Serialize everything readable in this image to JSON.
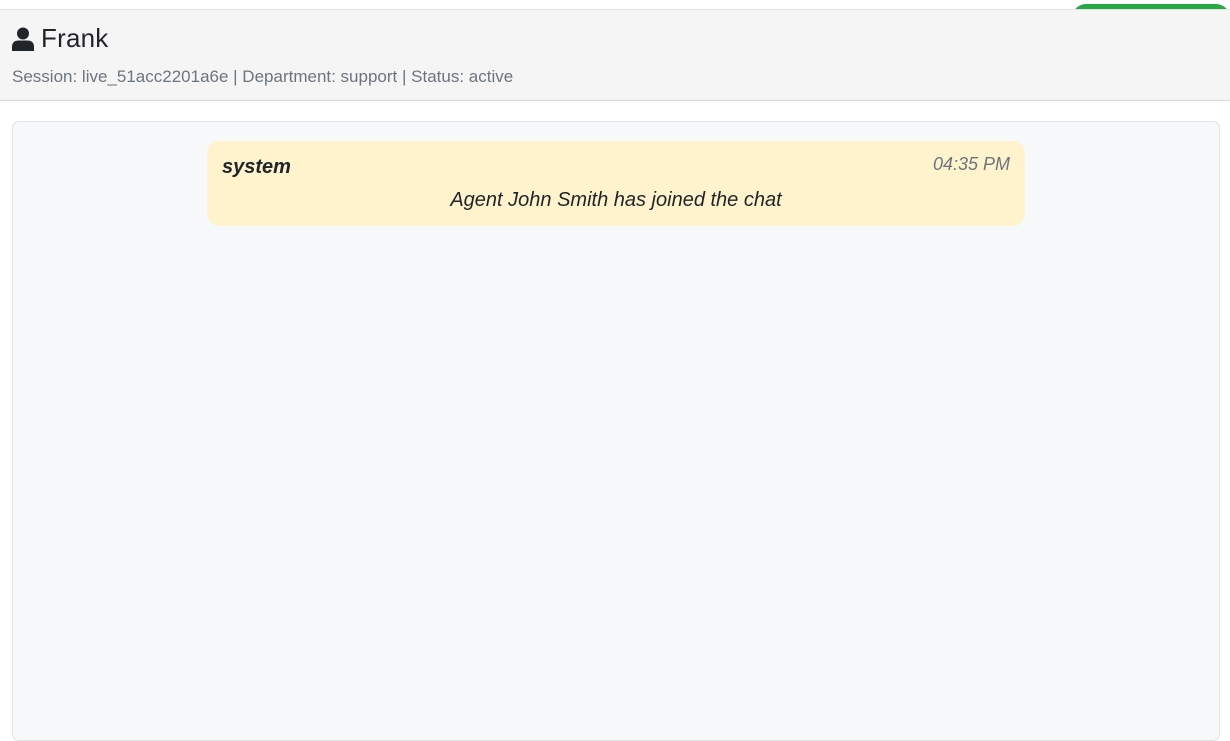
{
  "header": {
    "name": "Frank",
    "meta": "Session: live_51acc2201a6e | Department: support | Status: active",
    "icon": "user-icon"
  },
  "messages": [
    {
      "sender": "system",
      "time": "04:35 PM",
      "text": "Agent John Smith has joined the chat"
    }
  ],
  "colors": {
    "header_bg": "#f5f5f5",
    "panel_bg": "#f7f8fa",
    "system_bubble": "#fff3cd",
    "accent_green": "#28a745",
    "muted_text": "#6c757d"
  }
}
